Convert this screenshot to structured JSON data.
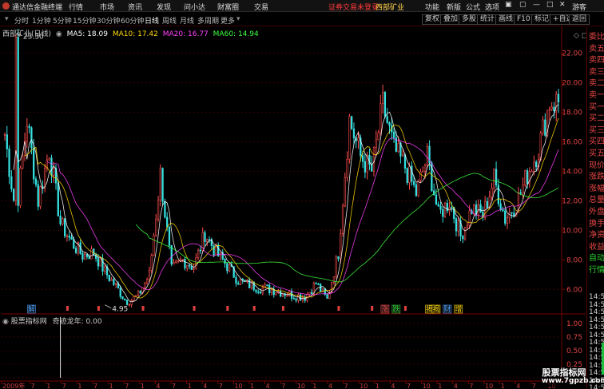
{
  "titlebar": {
    "app_title": "通达信金融终端",
    "menus": [
      "行情",
      "市场",
      "资讯",
      "发现",
      "问小达",
      "财富圈",
      "交易"
    ],
    "login_notice": "证券交易未登录",
    "stock_name": "西部矿业",
    "right_menus": [
      "功能",
      "新版",
      "公式",
      "选项"
    ],
    "guest": "游客",
    "icons": [
      "phone-icon",
      "restore-icon",
      "minimize-icon",
      "maximize-icon",
      "close-icon"
    ]
  },
  "period_bar": {
    "periods": [
      "分时",
      "1分钟",
      "5分钟",
      "15分钟",
      "30分钟",
      "60分钟",
      "日线",
      "周线",
      "月线",
      "多周期",
      "更多"
    ],
    "active": "日线",
    "tools": [
      "复权",
      "叠加",
      "多股",
      "统计",
      "画线",
      "F10",
      "标记",
      "+自选",
      "返回"
    ]
  },
  "legend": {
    "stock": "西部矿业(日线)",
    "ma": [
      {
        "label": "MA5: 18.09",
        "color": "#ffffff"
      },
      {
        "label": "MA10: 17.42",
        "color": "#ffd700"
      },
      {
        "label": "MA20: 16.77",
        "color": "#ff40ff"
      },
      {
        "label": "MA60: 14.94",
        "color": "#40ff40"
      }
    ]
  },
  "sub_legend": {
    "name": "股票指标网",
    "indicator": "奇迹龙年: 0.00"
  },
  "right_panel": {
    "labels": [
      "委比",
      "卖五",
      "卖四",
      "卖三",
      "卖二",
      "卖一",
      "买一",
      "买二",
      "买三",
      "买四",
      "买五",
      "现价",
      "涨跌",
      "涨幅",
      "总量",
      "外盘",
      "换手",
      "净资",
      "收益",
      "自动",
      "行情"
    ],
    "times": [
      "14:5",
      "14:5",
      "14:5",
      "14:5",
      "14:5",
      "14:5",
      "14:5",
      "14:5",
      "14:5",
      "14:5",
      "14:5",
      "14:5",
      "14:5"
    ]
  },
  "markers": {
    "events": [
      "解",
      "涨",
      "跌",
      "揭",
      "揭",
      "财",
      "增"
    ]
  },
  "x_axis": {
    "labels": [
      "2009年",
      "7",
      "1",
      "7",
      "1",
      "7",
      "1",
      "7",
      "1",
      "4",
      "7",
      "1",
      "4",
      "7",
      "10",
      "1",
      "4",
      "7",
      "10",
      "1",
      "4",
      "7",
      "10",
      "1",
      "4",
      "7",
      "10",
      "1",
      "4",
      "7",
      "10",
      "1",
      "4",
      "7",
      "10"
    ]
  },
  "watermark": {
    "line1": "股票指标网",
    "line2": "www.7gpzb.com"
  },
  "chart_data": [
    {
      "type": "candlestick",
      "title": "西部矿业(日线)",
      "y_ticks": [
        6.0,
        8.0,
        10.0,
        12.0,
        14.0,
        16.0,
        18.0,
        20.0,
        22.0
      ],
      "ylim": [
        4.5,
        23.6
      ],
      "annotations": [
        {
          "label": "23.30",
          "value": 23.3
        },
        {
          "label": "4.95",
          "value": 4.95
        }
      ],
      "series": [
        {
          "name": "Close",
          "x_index": [
            0,
            5,
            10,
            15,
            20,
            25,
            30,
            35,
            40,
            45,
            50,
            55,
            60,
            65,
            70,
            75,
            80,
            85,
            90,
            95,
            100,
            105,
            110,
            115,
            120,
            125,
            130,
            135,
            140,
            145,
            150,
            155,
            160,
            165,
            170,
            175,
            180,
            185,
            190,
            195,
            200,
            205,
            210,
            215,
            220,
            225,
            230,
            235,
            240,
            245
          ],
          "values": [
            16.5,
            11.0,
            17.5,
            12.0,
            15.5,
            10.5,
            9.2,
            8.3,
            8.5,
            7.2,
            6.2,
            5.1,
            5.6,
            7.0,
            13.8,
            7.3,
            8.0,
            7.5,
            9.8,
            8.5,
            7.6,
            6.6,
            6.3,
            6.1,
            6.0,
            5.8,
            5.6,
            5.5,
            6.4,
            5.3,
            8.5,
            17.5,
            15.0,
            14.0,
            18.5,
            15.5,
            14.3,
            12.5,
            15.0,
            11.0,
            12.0,
            9.6,
            11.5,
            11.0,
            13.5,
            10.8,
            11.8,
            13.8,
            15.5,
            18.7
          ]
        }
      ]
    },
    {
      "type": "bar",
      "title": "奇迹龙年",
      "y_ticks": [
        0.0,
        0.25,
        0.5,
        0.75,
        1.0
      ],
      "ylim": [
        0.0,
        1.1
      ],
      "series": [
        {
          "name": "奇迹龙年",
          "x_index": [
            25
          ],
          "values": [
            1.0
          ]
        }
      ]
    }
  ]
}
